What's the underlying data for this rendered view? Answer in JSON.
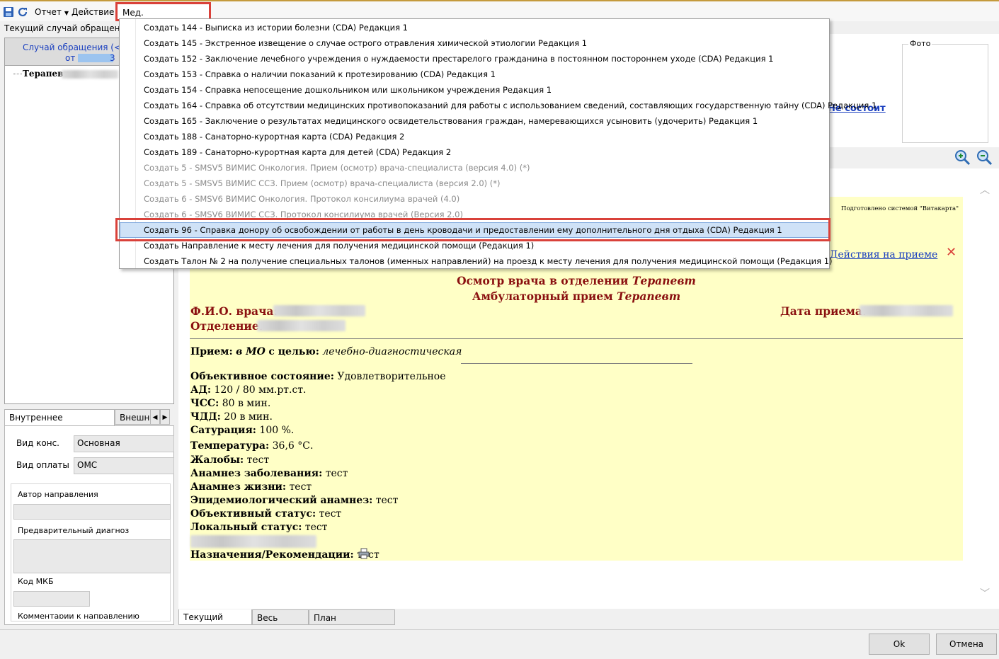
{
  "toolbar": {
    "report": "Отчет",
    "action": "Действие",
    "med_docs": "Мед. документация"
  },
  "left": {
    "current_case_label": "Текущий случай обращения",
    "case_header_line1": "Случай обращения (<не",
    "case_header_line2": "от",
    "case_header_line2_end": "3",
    "tree_item": "Терапевт"
  },
  "photo": {
    "label": "Фото"
  },
  "link_not_member": "Не состоит",
  "menu": {
    "items": [
      {
        "label": "Создать 144 -  Выписка из истории болезни (CDA) Редакция 1",
        "disabled": false
      },
      {
        "label": "Создать 145 - Экстренное извещение о случае острого отравления химической этиологии Редакция 1",
        "disabled": false
      },
      {
        "label": "Создать 152 - Заключение лечебного учреждения о нуждаемости престарелого гражданина в постоянном постороннем уходе (CDA) Редакция 1",
        "disabled": false
      },
      {
        "label": "Создать 153 - Справка о наличии показаний к протезированию (CDA) Редакция 1",
        "disabled": false
      },
      {
        "label": "Создать 154 - Справка непосещение дошкольником или школьником учреждения Редакция 1",
        "disabled": false
      },
      {
        "label": "Создать 164 - Справка об отсутствии медицинских противопоказаний для работы с использованием сведений, составляющих государственную тайну (CDA) Редакция 1",
        "disabled": false
      },
      {
        "label": "Создать 165 - Заключение о результатах медицинского освидетельствования граждан, намеревающихся усыновить (удочерить) Редакция 1",
        "disabled": false
      },
      {
        "label": "Создать 188 - Санаторно-курортная карта (CDA) Редакция 2",
        "disabled": false
      },
      {
        "label": "Создать 189 - Санаторно-курортная карта для детей (CDA) Редакция 2",
        "disabled": false
      },
      {
        "label": "Создать 5 - SMSV5 ВИМИС Онкология. Прием (осмотр) врача-специалиста  (версия 4.0) (*)",
        "disabled": true
      },
      {
        "label": "Создать 5 - SMSV5 ВИМИС ССЗ. Прием (осмотр) врача-специалиста (версия 2.0) (*)",
        "disabled": true
      },
      {
        "label": "Создать 6 - SMSV6 ВИМИС Онкология. Протокол консилиума врачей (4.0)",
        "disabled": true
      },
      {
        "label": "Создать 6 - SMSV6 ВИМИС ССЗ. Протокол консилиума врачей (Версия 2.0)",
        "disabled": true
      },
      {
        "label": "Создать 96 - Справка донору об освобождении от работы в день кроводачи и предоставлении ему дополнительного дня отдыха (CDA) Редакция 1",
        "disabled": false,
        "selected": true
      },
      {
        "label": "Создать Направление к месту лечения для получения медицинской помощи (Редакция 1)",
        "disabled": false
      },
      {
        "label": "Создать Талон № 2 на получение специальных талонов (именных направлений) на проезд к месту лечения для получения медицинской помощи (Редакция 1)",
        "disabled": false
      }
    ]
  },
  "referral": {
    "tab_internal": "Внутреннее направление",
    "tab_external": "Внешне",
    "cons_type_label": "Вид конс.",
    "cons_type_value": "Основная",
    "payment_label": "Вид оплаты",
    "payment_value": "ОМС",
    "author_label": "Автор направления",
    "prelim_diag_label": "Предварительный диагноз",
    "mkb_label": "Код МКБ",
    "comments_label": "Комментарии к направлению"
  },
  "actions_link": "Действия на приеме",
  "doc": {
    "prepared_by": "Подготовлено системой \"Витакарта\"",
    "title1_prefix": "Осмотр врача в отделении",
    "title1_italic": "Терапевт",
    "title2_prefix": "Амбулаторный прием",
    "title2_italic": "Терапевт",
    "doctor_label": "Ф.И.О. врача:",
    "department_label": "Отделение:",
    "date_label": "Дата приема:",
    "reception_label": "Прием:",
    "reception_place": "в МО",
    "reception_purpose_label": "с целью:",
    "reception_purpose": "лечебно-диагностическая",
    "objective_label": "Объективное состояние:",
    "objective_value": "Удовлетворительное",
    "bp_label": "АД:",
    "bp_value": "120 / 80 мм.рт.ст.",
    "hr_label": "ЧСС:",
    "hr_value": "80 в мин.",
    "rr_label": "ЧДД:",
    "rr_value": "20 в мин.",
    "sat_label": "Сатурация:",
    "sat_value": "100 %.",
    "temp_label": "Температура:",
    "temp_value": "36,6",
    "temp_unit": "°С.",
    "complaints_label": "Жалобы:",
    "complaints_value": "тест",
    "anamnesis_disease_label": "Анамнез заболевания:",
    "anamnesis_disease_value": "тест",
    "anamnesis_life_label": "Анамнез жизни:",
    "anamnesis_life_value": "тест",
    "epid_label": "Эпидемиологический анамнез:",
    "epid_value": "тест",
    "obj_status_label": "Объективный статус:",
    "obj_status_value": "тест",
    "local_status_label": "Локальный статус:",
    "local_status_value": "тест",
    "recommend_label": "Назначения/Рекомендации:",
    "recommend_value": "тест"
  },
  "bottom_tabs": [
    "Текущий осмотр",
    "Весь случай",
    "План обследования"
  ],
  "buttons": {
    "ok": "Ok",
    "cancel": "Отмена"
  }
}
